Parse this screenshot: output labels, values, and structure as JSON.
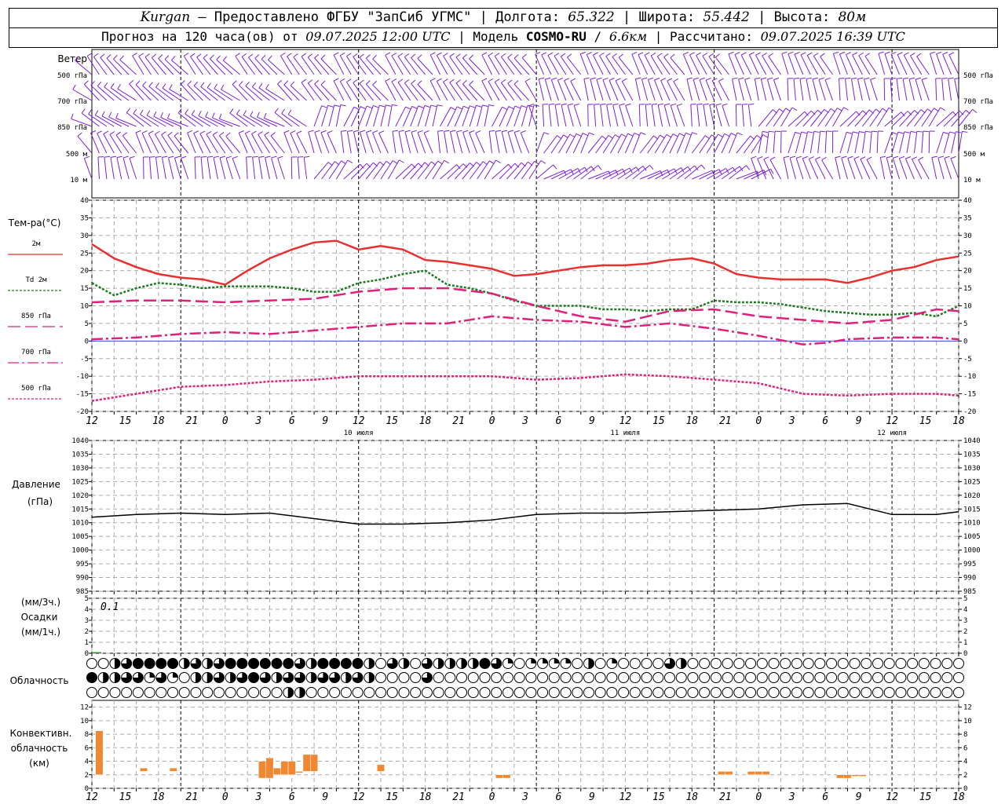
{
  "header": {
    "station": "Kurgan",
    "source": "— Предоставлено ФГБУ \"ЗапСиб УГМС\"",
    "lon_label": "Долгота:",
    "lon": "65.322",
    "lat_label": "Широта:",
    "lat": "55.442",
    "alt_label": "Высота:",
    "alt": "80м",
    "forecast_prefix": "Прогноз на 120 часа(ов) от",
    "forecast_time": "09.07.2025 12:00 UTC",
    "model_label": "Модель",
    "model": "COSMO-RU",
    "resolution": "6.6км",
    "calc_label": "Рассчитано:",
    "calc_time": "09.07.2025 16:39 UTC"
  },
  "wind_panel": {
    "title": "Ветер",
    "levels": [
      "500 гПа",
      "700 гПа",
      "850 гПа",
      "500 м",
      "10  м"
    ],
    "color": "#7f1fd6"
  },
  "x_axis": {
    "hour_labels": [
      "12",
      "15",
      "18",
      "21",
      "0",
      "3",
      "6",
      "9",
      "12",
      "15",
      "18",
      "21",
      "0",
      "3",
      "6",
      "9",
      "12",
      "15",
      "18",
      "21",
      "0",
      "3",
      "6",
      "9",
      "12",
      "15",
      "18"
    ],
    "day_labels": [
      "10 июля",
      "11 июля",
      "12 июля"
    ]
  },
  "chart_data": [
    {
      "type": "line",
      "ylabel": "Тем-ра(°С)",
      "ylim": [
        -20,
        40
      ],
      "yticks": [
        -20,
        -15,
        -10,
        -5,
        0,
        5,
        10,
        15,
        20,
        25,
        30,
        35,
        40
      ],
      "x_unit": "hours from 09.07.2025 12:00 UTC",
      "grid": true,
      "series": [
        {
          "name": "2м",
          "color": "#e8302e",
          "dash": "solid",
          "x": [
            0,
            3,
            6,
            9,
            12,
            15,
            18,
            21,
            24,
            27,
            30,
            33,
            36,
            39,
            42,
            45,
            48,
            51,
            54,
            57,
            60,
            63,
            66,
            69,
            72,
            75,
            78,
            81,
            84,
            87,
            90,
            93,
            96,
            99,
            102,
            105,
            108,
            111,
            114,
            117
          ],
          "values": [
            27.5,
            23.5,
            21,
            19,
            18,
            17.5,
            16,
            20,
            23.5,
            26,
            28,
            28.5,
            26,
            27,
            26,
            23,
            22.5,
            21.5,
            20.5,
            18.5,
            19,
            20,
            21,
            21.5,
            21.5,
            22,
            23,
            23.5,
            22,
            19,
            18,
            17.5,
            17.5,
            17.5,
            16.5,
            18,
            20,
            21,
            23,
            24
          ]
        },
        {
          "name": "Td 2м",
          "color": "#1f7a1f",
          "dash": "3,2",
          "x": [
            0,
            3,
            6,
            9,
            12,
            15,
            18,
            21,
            24,
            27,
            30,
            33,
            36,
            39,
            42,
            45,
            48,
            51,
            54,
            57,
            60,
            63,
            66,
            69,
            72,
            75,
            78,
            81,
            84,
            87,
            90,
            93,
            96,
            99,
            102,
            105,
            108,
            111,
            114,
            117
          ],
          "values": [
            16.5,
            13,
            15,
            16.5,
            16,
            15,
            15.5,
            15.5,
            15.5,
            15,
            14,
            14,
            16.5,
            17.5,
            19,
            20,
            16,
            15,
            13.5,
            11.5,
            10,
            10,
            10,
            9,
            9,
            8.5,
            9,
            9,
            11.5,
            11,
            11,
            10.5,
            9.5,
            8.5,
            8,
            7.5,
            7.5,
            8,
            7,
            10
          ]
        },
        {
          "name": "850 гПа",
          "color": "#e0207a",
          "dash": "16,6",
          "x": [
            0,
            6,
            12,
            18,
            24,
            30,
            36,
            42,
            48,
            54,
            60,
            66,
            72,
            78,
            84,
            90,
            96,
            102,
            108,
            114,
            117
          ],
          "values": [
            11,
            11.5,
            11.5,
            11,
            11.5,
            12,
            14,
            15,
            15,
            13.5,
            10,
            7,
            5.5,
            8.5,
            9,
            7,
            6,
            5,
            6,
            9,
            8.5
          ]
        },
        {
          "name": "700 гПа",
          "color": "#e0207a",
          "dash": "14,4,3,4",
          "x": [
            0,
            6,
            12,
            18,
            24,
            30,
            36,
            42,
            48,
            54,
            60,
            66,
            72,
            78,
            84,
            90,
            96,
            99,
            102,
            108,
            114,
            117
          ],
          "values": [
            0.5,
            1,
            2,
            2.5,
            2,
            3,
            4,
            5,
            5,
            7,
            6,
            5.5,
            4,
            5,
            3.5,
            1.5,
            -1,
            -0.5,
            0.5,
            1,
            1,
            0.5
          ]
        },
        {
          "name": "500 гПа",
          "color": "#e0207a",
          "dash": "3,2",
          "x": [
            0,
            6,
            12,
            18,
            24,
            30,
            36,
            42,
            48,
            54,
            60,
            66,
            72,
            78,
            84,
            90,
            96,
            102,
            108,
            114,
            117
          ],
          "values": [
            -17,
            -15,
            -13,
            -12.5,
            -11.5,
            -11,
            -10,
            -10,
            -10,
            -10,
            -11,
            -10.5,
            -9.5,
            -10,
            -11,
            -12,
            -15,
            -15.5,
            -15,
            -15,
            -15.5
          ]
        }
      ]
    },
    {
      "type": "line",
      "ylabel": "Давление",
      "yunit": "(гПа)",
      "ylim": [
        985,
        1040
      ],
      "yticks": [
        985,
        990,
        995,
        1000,
        1005,
        1010,
        1015,
        1020,
        1025,
        1030,
        1035,
        1040
      ],
      "grid": true,
      "series": [
        {
          "name": "",
          "color": "#000000",
          "dash": "solid",
          "x": [
            0,
            6,
            12,
            18,
            24,
            30,
            36,
            42,
            48,
            54,
            60,
            66,
            72,
            78,
            84,
            90,
            96,
            102,
            108,
            114,
            117
          ],
          "values": [
            1012,
            1013,
            1013.5,
            1013,
            1013.5,
            1011.5,
            1009.5,
            1009.5,
            1010,
            1011,
            1013,
            1013.5,
            1013.5,
            1014,
            1014.5,
            1015,
            1016.5,
            1017,
            1013,
            1013,
            1014
          ]
        }
      ]
    },
    {
      "type": "bar",
      "ylabel": "Осадки",
      "yunit_top": "(мм/3ч.)",
      "yunit_bottom": "(мм/1ч.)",
      "ylim": [
        0,
        5
      ],
      "yticks": [
        0,
        1,
        2,
        3,
        4,
        5
      ],
      "annotation": "0.1",
      "x": [
        0
      ],
      "values": [
        0.1
      ],
      "color": "#1f9e1f"
    },
    {
      "type": "bar",
      "ylabel": "Конвективн. облачность (км)",
      "ylim": [
        0,
        13
      ],
      "yticks": [
        0,
        2,
        4,
        6,
        8,
        10,
        12
      ],
      "color": "#ee8833",
      "bars": [
        {
          "x": 1,
          "base": 2,
          "top": 8.5
        },
        {
          "x": 7,
          "base": 2.5,
          "top": 3
        },
        {
          "x": 11,
          "base": 2.5,
          "top": 3
        },
        {
          "x": 23,
          "base": 1.5,
          "top": 4
        },
        {
          "x": 24,
          "base": 1.5,
          "top": 4.5
        },
        {
          "x": 25,
          "base": 2,
          "top": 3
        },
        {
          "x": 26,
          "base": 2,
          "top": 4
        },
        {
          "x": 27,
          "base": 2,
          "top": 4
        },
        {
          "x": 28,
          "base": 2.5,
          "top": 2.5
        },
        {
          "x": 29,
          "base": 2.5,
          "top": 5
        },
        {
          "x": 30,
          "base": 2.5,
          "top": 5
        },
        {
          "x": 39,
          "base": 2.5,
          "top": 3.5
        },
        {
          "x": 55,
          "base": 1.5,
          "top": 2
        },
        {
          "x": 56,
          "base": 1.5,
          "top": 2
        },
        {
          "x": 85,
          "base": 2,
          "top": 2.5
        },
        {
          "x": 86,
          "base": 2,
          "top": 2.5
        },
        {
          "x": 89,
          "base": 2,
          "top": 2.5
        },
        {
          "x": 90,
          "base": 2,
          "top": 2.5
        },
        {
          "x": 91,
          "base": 2,
          "top": 2.5
        },
        {
          "x": 101,
          "base": 1.5,
          "top": 2
        },
        {
          "x": 102,
          "base": 1.5,
          "top": 2
        },
        {
          "x": 103,
          "base": 2,
          "top": 2
        },
        {
          "x": 104,
          "base": 2,
          "top": 2
        }
      ]
    }
  ],
  "clouds": {
    "title": "Облачность",
    "levels": [
      "high",
      "middle",
      "low"
    ],
    "encoding": "cover in eighths: 0 clear circle, 2 quarter, 4 half, 6 three-quarter, 8 full",
    "rows": [
      [
        0,
        0,
        4,
        6,
        8,
        8,
        8,
        8,
        4,
        6,
        4,
        6,
        8,
        8,
        8,
        8,
        8,
        8,
        6,
        4,
        8,
        8,
        8,
        8,
        4,
        0,
        6,
        4,
        0,
        6,
        4,
        4,
        4,
        4,
        8,
        6,
        2,
        0,
        2,
        2,
        2,
        2,
        0,
        4,
        0,
        2,
        0,
        0,
        0,
        0,
        6,
        4,
        0,
        0,
        0,
        0,
        0,
        0,
        0,
        0,
        0,
        0,
        0,
        0,
        0,
        0,
        0,
        0,
        0,
        0,
        0,
        0,
        0,
        0,
        0,
        0
      ],
      [
        8,
        4,
        4,
        6,
        6,
        2,
        6,
        2,
        0,
        4,
        4,
        6,
        4,
        6,
        8,
        6,
        4,
        6,
        6,
        4,
        6,
        6,
        4,
        6,
        4,
        0,
        0,
        0,
        0,
        6,
        0,
        0,
        0,
        0,
        0,
        0,
        0,
        0,
        0,
        0,
        0,
        0,
        0,
        0,
        0,
        0,
        0,
        0,
        0,
        0,
        0,
        0,
        0,
        0,
        0,
        0,
        0,
        0,
        0,
        0,
        0,
        0,
        0,
        0,
        0,
        0,
        0,
        0,
        0,
        0,
        0,
        0,
        0,
        0,
        0,
        0
      ],
      [
        0,
        0,
        0,
        0,
        0,
        0,
        0,
        0,
        0,
        0,
        0,
        0,
        0,
        0,
        0,
        0,
        0,
        4,
        4,
        0,
        0,
        0,
        0,
        0,
        0,
        0,
        0,
        0,
        0,
        0,
        0,
        0,
        0,
        0,
        0,
        0,
        0,
        0,
        0,
        0,
        0,
        0,
        0,
        0,
        0,
        0,
        0,
        0,
        0,
        0,
        0,
        0,
        0,
        0,
        0,
        0,
        0,
        0,
        0,
        0,
        0,
        0,
        0,
        0,
        0,
        0,
        0,
        0,
        0,
        0,
        0,
        0,
        0,
        0,
        0,
        0
      ]
    ]
  }
}
